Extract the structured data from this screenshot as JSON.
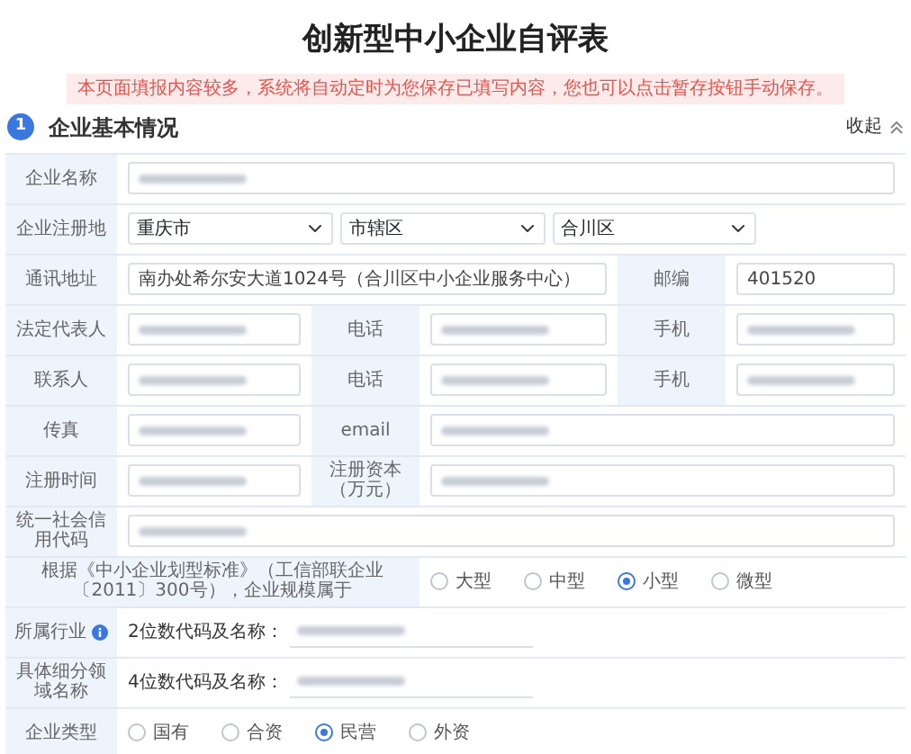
{
  "title": "创新型中小企业自评表",
  "notice": "本页面填报内容较多，系统将自动定时为您保存已填写内容，您也可以点击暂存按钮手动保存。",
  "section": {
    "number": "1",
    "title": "企业基本情况",
    "collapse": "收起",
    "expanded": true
  },
  "rows": [
    {
      "cells": [
        {
          "kind": "label",
          "text": "企业名称"
        },
        {
          "kind": "input",
          "redacted": true
        }
      ]
    },
    {
      "cells": [
        {
          "kind": "label",
          "text": "企业注册地"
        },
        {
          "kind": "selects",
          "values": [
            "重庆市",
            "市辖区",
            "合川区"
          ]
        }
      ]
    },
    {
      "cells": [
        {
          "kind": "label",
          "text": "通讯地址"
        },
        {
          "kind": "wide-input",
          "value": "南办处希尔安大道1024号（合川区中小企业服务中心）"
        },
        {
          "kind": "label",
          "text": "邮编"
        },
        {
          "kind": "input",
          "value": "401520"
        }
      ]
    },
    {
      "cells": [
        {
          "kind": "label",
          "text": "法定代表人"
        },
        {
          "kind": "input",
          "redacted": true
        },
        {
          "kind": "label",
          "text": "电话"
        },
        {
          "kind": "input",
          "redacted": true
        },
        {
          "kind": "label",
          "text": "手机"
        },
        {
          "kind": "input",
          "redacted": true
        }
      ]
    },
    {
      "cells": [
        {
          "kind": "label",
          "text": "联系人"
        },
        {
          "kind": "input",
          "redacted": true
        },
        {
          "kind": "label",
          "text": "电话"
        },
        {
          "kind": "input",
          "redacted": true
        },
        {
          "kind": "label",
          "text": "手机"
        },
        {
          "kind": "input",
          "redacted": true
        }
      ]
    },
    {
      "cells": [
        {
          "kind": "label",
          "text": "传真"
        },
        {
          "kind": "input",
          "redacted": true
        },
        {
          "kind": "label",
          "text": "email"
        },
        {
          "kind": "input",
          "redacted": true
        }
      ]
    },
    {
      "cells": [
        {
          "kind": "label",
          "text": "注册时间"
        },
        {
          "kind": "input",
          "redacted": true
        },
        {
          "kind": "label",
          "text": "注册资本（万元）"
        },
        {
          "kind": "input",
          "redacted": true
        }
      ]
    },
    {
      "cells": [
        {
          "kind": "label",
          "text": "统一社会信用代码"
        },
        {
          "kind": "input",
          "redacted": true
        }
      ]
    },
    {
      "cells": [
        {
          "kind": "wide-label",
          "text": "根据《中小企业划型标准》（工信部联企业〔2011〕300号），企业规模属于"
        },
        {
          "kind": "radios",
          "options": [
            {
              "label": "大型",
              "selected": false
            },
            {
              "label": "中型",
              "selected": false
            },
            {
              "label": "小型",
              "selected": true
            },
            {
              "label": "微型",
              "selected": false
            }
          ]
        }
      ]
    },
    {
      "cells": [
        {
          "kind": "label",
          "text": "所属行业",
          "info": true
        },
        {
          "kind": "coded",
          "prefix": "2位数代码及名称：",
          "redacted": true
        }
      ]
    },
    {
      "cells": [
        {
          "kind": "label",
          "text": "具体细分领域名称"
        },
        {
          "kind": "coded",
          "prefix": "4位数代码及名称：",
          "redacted": true
        }
      ]
    },
    {
      "cells": [
        {
          "kind": "label",
          "text": "企业类型"
        },
        {
          "kind": "radios",
          "options": [
            {
              "label": "国有",
              "selected": false
            },
            {
              "label": "合资",
              "selected": false
            },
            {
              "label": "民营",
              "selected": true
            },
            {
              "label": "外资",
              "selected": false
            }
          ]
        }
      ]
    }
  ]
}
